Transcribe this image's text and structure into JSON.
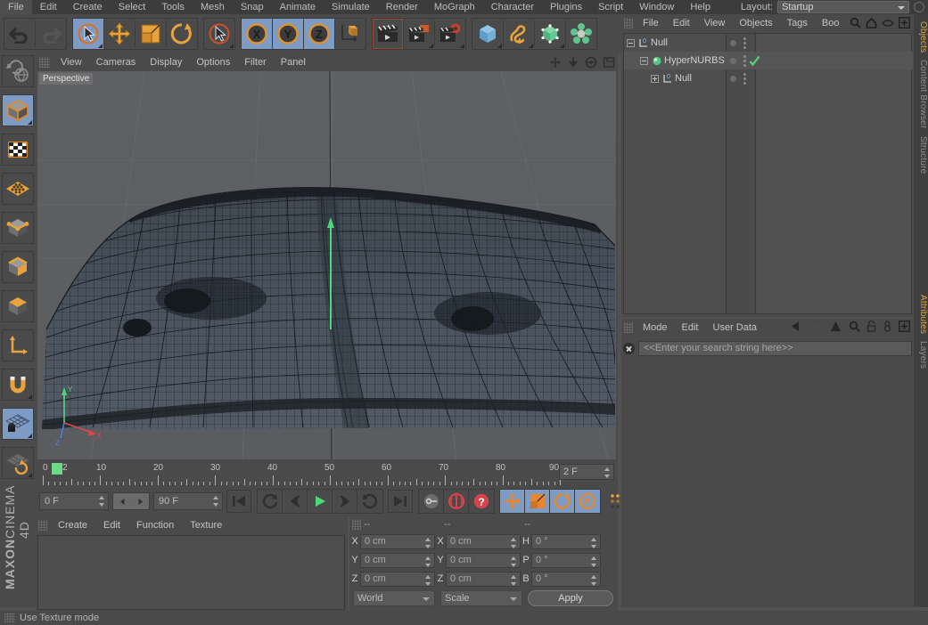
{
  "menubar": {
    "items": [
      "File",
      "Edit",
      "Create",
      "Select",
      "Tools",
      "Mesh",
      "Snap",
      "Animate",
      "Simulate",
      "Render",
      "MoGraph",
      "Character",
      "Plugins",
      "Script",
      "Window",
      "Help"
    ],
    "layout_label": "Layout:",
    "layout_value": "Startup"
  },
  "toolbar": {
    "groups": [
      {
        "buttons": [
          {
            "name": "undo-button",
            "icon": "undo-arrow",
            "selected": false
          },
          {
            "name": "redo-button",
            "icon": "redo-arrow",
            "selected": false
          }
        ]
      },
      {
        "buttons": [
          {
            "name": "live-selection-tool",
            "icon": "cursor-circle",
            "selected": true
          },
          {
            "name": "move-tool",
            "icon": "move-cross",
            "selected": false
          },
          {
            "name": "scale-tool",
            "icon": "scale-box",
            "selected": false
          },
          {
            "name": "rotate-tool",
            "icon": "rotate-circle",
            "selected": false
          }
        ]
      },
      {
        "buttons": [
          {
            "name": "selection-mode-tool",
            "icon": "cursor-circle-red",
            "selected": false
          }
        ]
      },
      {
        "buttons": [
          {
            "name": "lock-x-axis",
            "icon": "axis-x",
            "selected": true
          },
          {
            "name": "lock-y-axis",
            "icon": "axis-y",
            "selected": true
          },
          {
            "name": "lock-z-axis",
            "icon": "axis-z",
            "selected": true
          },
          {
            "name": "world-object-coordinates",
            "icon": "axis-world",
            "selected": false
          }
        ]
      },
      {
        "buttons": [
          {
            "name": "render-view-button",
            "icon": "clapper-view",
            "selected": false
          },
          {
            "name": "render-to-picture-viewer-button",
            "icon": "clapper-picture",
            "selected": false
          },
          {
            "name": "render-settings-button",
            "icon": "clapper-gear",
            "selected": false
          }
        ]
      },
      {
        "buttons": [
          {
            "name": "add-cube-object",
            "icon": "cube-blue",
            "selected": false
          },
          {
            "name": "add-spline-object",
            "icon": "spline-orange",
            "selected": false
          },
          {
            "name": "add-nurbs-object",
            "icon": "hypernurbs-green",
            "selected": false
          },
          {
            "name": "add-array-object",
            "icon": "array-green",
            "selected": false
          }
        ]
      }
    ]
  },
  "left_palette": {
    "buttons": [
      {
        "name": "undo-view-tool",
        "icon": "undo-view",
        "selected": false
      },
      {
        "name": "model-mode-tool",
        "icon": "cube-orange-outline",
        "selected": true
      },
      {
        "name": "texture-mode-tool",
        "icon": "checker-texture",
        "selected": false
      },
      {
        "name": "point-mode-tool",
        "icon": "points-grid",
        "selected": false
      },
      {
        "name": "edge-mode-tool",
        "icon": "edge-cube",
        "selected": false
      },
      {
        "name": "polygon-mode-tool",
        "icon": "polygon-cube",
        "selected": false
      },
      {
        "name": "face-mode-tool",
        "icon": "face-cube",
        "selected": false
      },
      {
        "name": "axis-mode-tool",
        "icon": "axis-l",
        "selected": false
      },
      {
        "name": "magnet-tool",
        "icon": "magnet",
        "selected": false
      },
      {
        "name": "lock-workplane-tool",
        "icon": "workplane-lock",
        "selected": true
      },
      {
        "name": "workplane-tool",
        "icon": "workplane-rotate",
        "selected": false
      }
    ],
    "brand_line1": "MAXON",
    "brand_line2": "CINEMA 4D"
  },
  "viewport": {
    "menu": [
      "View",
      "Cameras",
      "Display",
      "Options",
      "Filter",
      "Panel"
    ],
    "label": "Perspective",
    "nav_icons": [
      "pan-icon",
      "dolly-icon",
      "orbit-icon",
      "maximize-icon"
    ]
  },
  "timeline": {
    "ruler_labels": [
      "0",
      "10",
      "20",
      "30",
      "40",
      "50",
      "60",
      "70",
      "80",
      "90"
    ],
    "ruler_min": 0,
    "ruler_max": 90,
    "current_frame_label": "2",
    "frame_field": "2 F",
    "start_field": "0 F",
    "end_field": "90 F",
    "buttons": [
      {
        "name": "go-to-start-button",
        "icon": "skip-start",
        "selected": false
      },
      {
        "name": "previous-key-button",
        "icon": "prev-key",
        "selected": false
      },
      {
        "name": "step-back-button",
        "icon": "step-back",
        "selected": false
      },
      {
        "name": "play-button",
        "icon": "play-triangle",
        "selected": false
      },
      {
        "name": "step-forward-button",
        "icon": "step-forward",
        "selected": false
      },
      {
        "name": "next-key-button",
        "icon": "next-key",
        "selected": false
      },
      {
        "name": "go-to-end-button",
        "icon": "skip-end",
        "selected": false
      },
      {
        "name": "record-active-objects-button",
        "icon": "key-record",
        "selected": false
      },
      {
        "name": "autokeying-button",
        "icon": "autokey-circle",
        "selected": false
      },
      {
        "name": "keyframe-selection-button",
        "icon": "question-circle",
        "selected": false
      },
      {
        "name": "position-key-toggle",
        "icon": "move-cross-small",
        "selected": true
      },
      {
        "name": "scale-key-toggle",
        "icon": "scale-box-small",
        "selected": true
      },
      {
        "name": "rotation-key-toggle",
        "icon": "rotate-circle-small",
        "selected": true
      },
      {
        "name": "parameter-key-toggle",
        "icon": "param-p-circle",
        "selected": true
      },
      {
        "name": "point-level-animation-toggle",
        "icon": "pla-dots",
        "selected": false
      }
    ]
  },
  "material_manager": {
    "menu": [
      "Create",
      "Edit",
      "Function",
      "Texture"
    ]
  },
  "coordinates": {
    "col_headers": [
      "--",
      "--",
      "--"
    ],
    "rows": [
      {
        "pos_label": "X",
        "pos_value": "0 cm",
        "size_label": "X",
        "size_value": "0 cm",
        "rot_label": "H",
        "rot_value": "0 °"
      },
      {
        "pos_label": "Y",
        "pos_value": "0 cm",
        "size_label": "Y",
        "size_value": "0 cm",
        "rot_label": "P",
        "rot_value": "0 °"
      },
      {
        "pos_label": "Z",
        "pos_value": "0 cm",
        "size_label": "Z",
        "size_value": "0 cm",
        "rot_label": "B",
        "rot_value": "0 °"
      }
    ],
    "coord_system": "World",
    "transform_mode": "Scale",
    "apply_label": "Apply"
  },
  "object_manager": {
    "menu": [
      "File",
      "Edit",
      "View",
      "Objects",
      "Tags",
      "Boo"
    ],
    "icons": [
      "search-icon",
      "home-icon",
      "eye-icon",
      "add-icon"
    ],
    "items": [
      {
        "name": "Null",
        "icon": "null-object-icon",
        "depth": 0,
        "expander": "minus",
        "tag_check": false
      },
      {
        "name": "HyperNURBS",
        "icon": "hypernurbs-object-icon",
        "depth": 1,
        "expander": "minus",
        "tag_check": true
      },
      {
        "name": "Null",
        "icon": "null-object-icon",
        "depth": 2,
        "expander": "plus",
        "tag_check": false
      }
    ]
  },
  "attributes": {
    "menu": [
      "Mode",
      "Edit",
      "User Data"
    ],
    "icons": [
      "back-arrow-icon",
      "forward-arrow-icon",
      "up-arrow-icon",
      "search-icon",
      "lock-icon",
      "link-icon",
      "add-icon"
    ],
    "search_placeholder": "<<Enter your search string here>>",
    "search_value": "<<Enter your search string here>>"
  },
  "right_tabs": {
    "top": [
      {
        "label": "Objects",
        "active": true
      },
      {
        "label": "Content Browser",
        "active": false
      },
      {
        "label": "Structure",
        "active": false
      }
    ],
    "bottom": [
      {
        "label": "Attributes",
        "active": true
      },
      {
        "label": "Layers",
        "active": false
      }
    ]
  },
  "statusbar": {
    "text": "Use Texture mode"
  },
  "colors": {
    "accent_orange": "#e08a2e",
    "selection_blue": "#7e9bc4",
    "panel_bg": "#4a4a4a",
    "viewport_bg": "#5e6063",
    "mesh_fill": "#4d5661",
    "green_marker": "#6cd98b",
    "tab_active": "#e0a13a"
  }
}
